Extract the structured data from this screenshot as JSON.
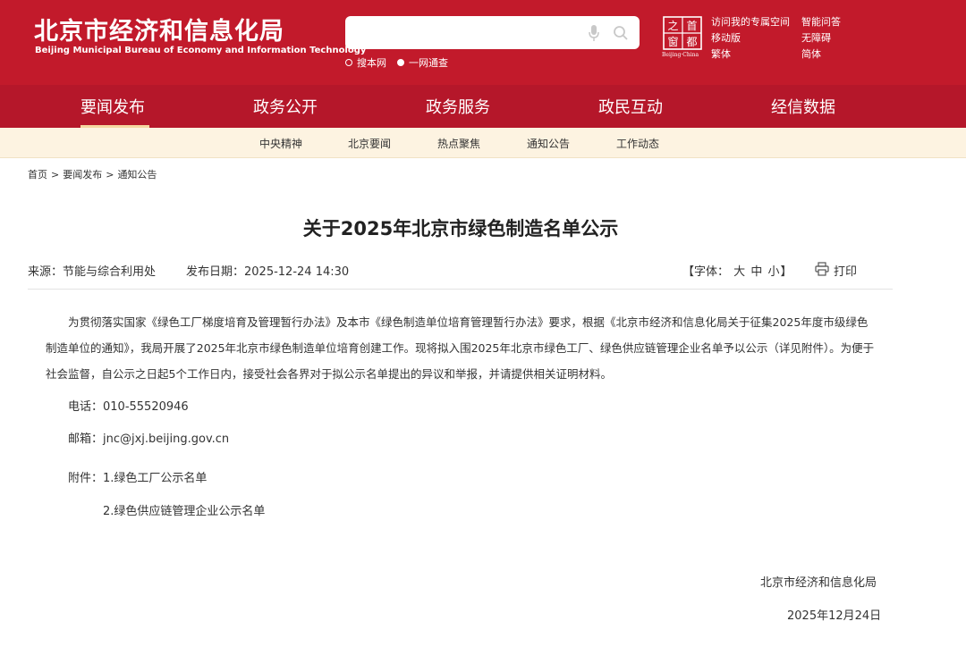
{
  "header": {
    "logo_cn": "北京市经济和信息化局",
    "logo_en": "Beijing Municipal Bureau of Economy and Information Technology",
    "search": {
      "value": "",
      "placeholder": ""
    },
    "scope": {
      "site": "搜本网",
      "portal": "一网通查"
    },
    "seal": {
      "chars": [
        "之",
        "首",
        "都",
        "窗"
      ],
      "caption": "Beijing·China"
    },
    "links": {
      "personal_space": "访问我的专属空间",
      "smart_qa": "智能问答",
      "mobile": "移动版",
      "accessibility": "无障碍",
      "traditional": "繁体",
      "simplified": "简体"
    },
    "colors": {
      "primary": "#c21a2b",
      "nav": "#b5172a",
      "subnav_bg": "#fdf3e1"
    }
  },
  "main_nav": [
    "要闻发布",
    "政务公开",
    "政务服务",
    "政民互动",
    "经信数据"
  ],
  "sub_nav": [
    "中央精神",
    "北京要闻",
    "热点聚焦",
    "通知公告",
    "工作动态"
  ],
  "breadcrumb": [
    "首页",
    "要闻发布",
    "通知公告"
  ],
  "breadcrumb_sep": ">",
  "article": {
    "title": "关于2025年北京市绿色制造名单公示",
    "source_label": "来源：",
    "source": "节能与综合利用处",
    "date_label": "发布日期：",
    "date": "2025-12-24 14:30",
    "font_label": "【字体：",
    "font_sizes": [
      "大",
      "中",
      "小"
    ],
    "font_close": "】",
    "print": "打印",
    "body": "为贯彻落实国家《绿色工厂梯度培育及管理暂行办法》及本市《绿色制造单位培育管理暂行办法》要求，根据《北京市经济和信息化局关于征集2025年度市级绿色制造单位的通知》，我局开展了2025年北京市绿色制造单位培育创建工作。现将拟入围2025年北京市绿色工厂、绿色供应链管理企业名单予以公示（详见附件）。为便于社会监督，自公示之日起5个工作日内，接受社会各界对于拟公示名单提出的异议和举报，并请提供相关证明材料。",
    "phone": "电话：010-55520946",
    "email": "邮箱：jnc@jxj.beijing.gov.cn",
    "attachments_label": "附件：",
    "attachments": [
      "1.绿色工厂公示名单",
      "2.绿色供应链管理企业公示名单"
    ],
    "signature": "北京市经济和信息化局",
    "sign_date": "2025年12月24日"
  }
}
